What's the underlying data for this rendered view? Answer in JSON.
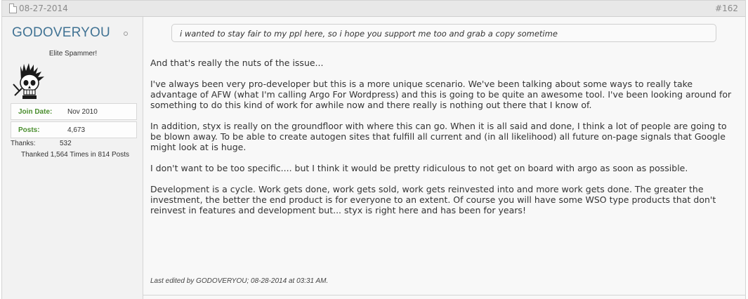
{
  "post": {
    "date": "08-27-2014",
    "number": "#162"
  },
  "user": {
    "name": "GODOVERYOU",
    "title": "Elite Spammer!",
    "avatar_icon": "mohawk-skull-icon",
    "join_date_label": "Join Date:",
    "join_date_value": "Nov 2010",
    "posts_label": "Posts:",
    "posts_value": "4,673",
    "thanks_label": "Thanks:",
    "thanks_value": "532",
    "thanked_text": "Thanked 1,564 Times in 814 Posts",
    "label_color": "#4a8e2e",
    "name_color": "#417394"
  },
  "quote": {
    "text": "i wanted to stay fair to my ppl here, so i hope you support me too and grab a copy sometime"
  },
  "message": {
    "paragraphs": [
      "And that's really the nuts of the issue...",
      "I've always been very pro-developer but this is a more unique scenario. We've been talking about some ways to really take advantage of AFW (what I'm calling Argo For Wordpress) and this is going to be quite an awesome tool. I've been looking around for something to do this kind of work for awhile now and there really is nothing out there that I know of.",
      "In addition, styx is really on the groundfloor with where this can go. When it is all said and done, I think a lot of people are going to be blown away. To be able to create autogen sites that fulfill all current and (in all likelihood) all future on-page signals that Google might look at is huge.",
      "I don't want to be too specific.... but I think it would be pretty ridiculous to not get on board with argo as soon as possible.",
      "Development is a cycle. Work gets done, work gets sold, work gets reinvested into and more work gets done. The greater the investment, the better the end product is for everyone to an extent. Of course you will have some WSO type products that don't reinvest in features and development but... styx is right here and has been for years!"
    ]
  },
  "last_edited": {
    "text": "Last edited by GODOVERYOU; 08-28-2014 at 03:31 AM."
  }
}
